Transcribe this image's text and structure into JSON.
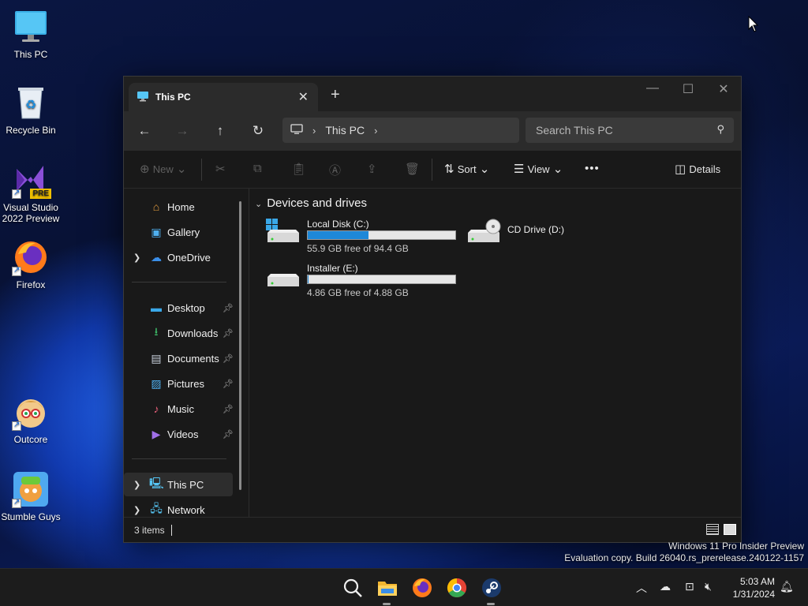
{
  "desktop": {
    "icons": [
      {
        "label": "This PC",
        "icon": "monitor-icon"
      },
      {
        "label": "Recycle Bin",
        "icon": "recycle-bin-icon"
      },
      {
        "label": "Visual Studio 2022 Preview",
        "line1": "Visual Studio",
        "line2": "2022 Preview",
        "badge": "PRE",
        "icon": "visual-studio-icon"
      },
      {
        "label": "Firefox",
        "icon": "firefox-icon"
      },
      {
        "label": "Outcore",
        "icon": "outcore-icon"
      },
      {
        "label": "Stumble Guys",
        "icon": "stumble-guys-icon"
      }
    ]
  },
  "window": {
    "tab_title": "This PC",
    "address": {
      "crumb": "This PC"
    },
    "search_placeholder": "Search This PC",
    "toolbar": {
      "new_label": "New",
      "sort_label": "Sort",
      "view_label": "View",
      "more_label": "•••",
      "details_label": "Details"
    },
    "nav": {
      "top": [
        {
          "label": "Home",
          "icon": "home-icon"
        },
        {
          "label": "Gallery",
          "icon": "gallery-icon"
        },
        {
          "label": "OneDrive",
          "icon": "onedrive-icon",
          "expandable": true
        }
      ],
      "pinned": [
        {
          "label": "Desktop",
          "icon": "desktop-folder-icon"
        },
        {
          "label": "Downloads",
          "icon": "downloads-icon"
        },
        {
          "label": "Documents",
          "icon": "documents-icon"
        },
        {
          "label": "Pictures",
          "icon": "pictures-icon"
        },
        {
          "label": "Music",
          "icon": "music-icon"
        },
        {
          "label": "Videos",
          "icon": "videos-icon"
        }
      ],
      "bottom": [
        {
          "label": "This PC",
          "icon": "this-pc-icon",
          "selected": true
        },
        {
          "label": "Network",
          "icon": "network-icon"
        }
      ]
    },
    "content": {
      "group_title": "Devices and drives",
      "drives": [
        {
          "name": "Local Disk (C:)",
          "free_text": "55.9 GB free of 94.4 GB",
          "used_fraction": 0.41
        },
        {
          "name": "CD Drive (D:)"
        },
        {
          "name": "Installer (E:)",
          "free_text": "4.86 GB free of 4.88 GB",
          "used_fraction": 0.004
        }
      ]
    },
    "status": {
      "items": "3 items"
    }
  },
  "watermark": {
    "line1": "Windows 11 Pro Insider Preview",
    "line2": "Evaluation copy. Build 26040.rs_prerelease.240122-1157"
  },
  "taskbar": {
    "time": "5:03 AM",
    "date": "1/31/2024"
  },
  "colors": {
    "accent": "#1e88d8",
    "window_bg": "#191919",
    "titlebar_bg": "#202020"
  }
}
